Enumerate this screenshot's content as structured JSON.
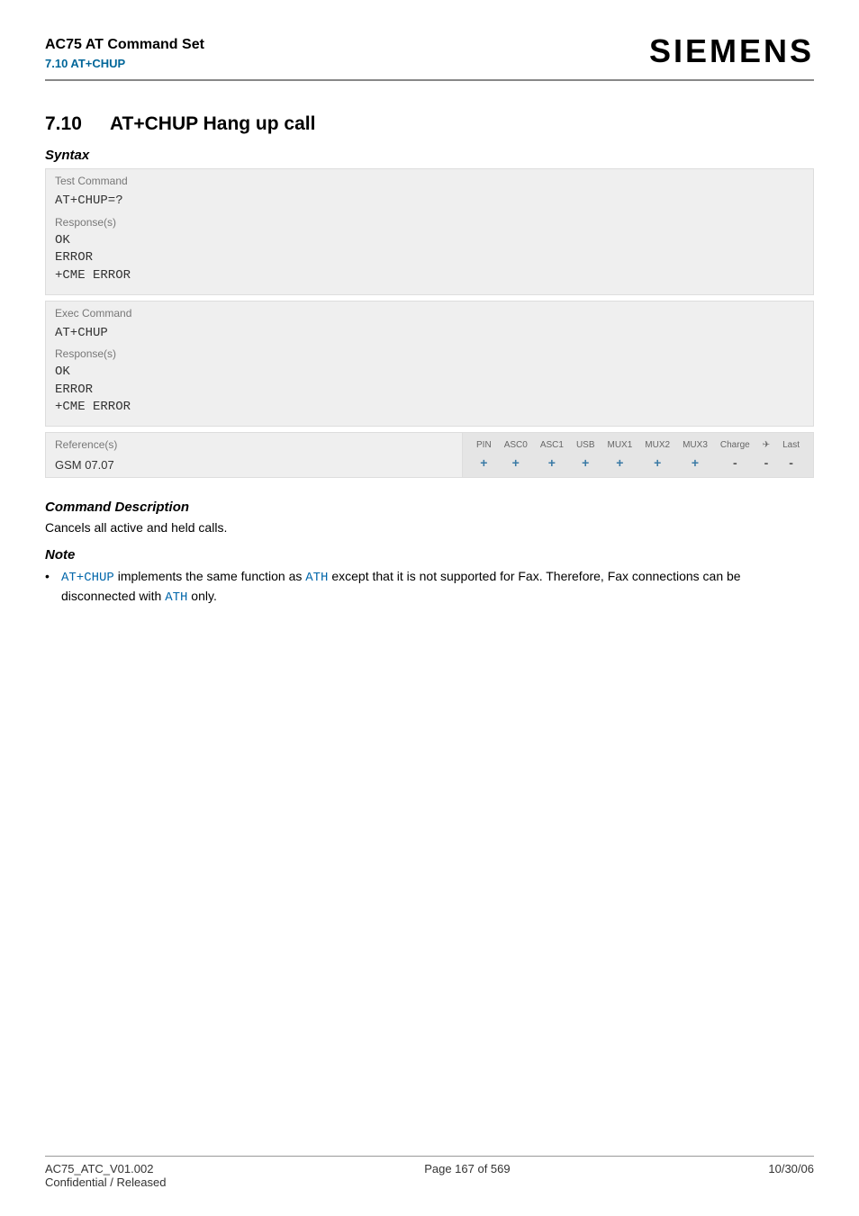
{
  "header": {
    "doc_title": "AC75 AT Command Set",
    "section_ref": "7.10 AT+CHUP",
    "brand": "SIEMENS"
  },
  "section": {
    "number": "7.10",
    "title": "AT+CHUP   Hang up call"
  },
  "syntax": {
    "heading": "Syntax",
    "test_cmd": {
      "label": "Test Command",
      "cmd": "AT+CHUP=?",
      "responses_label": "Response(s)",
      "lines": [
        "OK",
        "ERROR",
        "+CME ERROR"
      ]
    },
    "exec_cmd": {
      "label": "Exec Command",
      "cmd": "AT+CHUP",
      "responses_label": "Response(s)",
      "lines": [
        "OK",
        "ERROR",
        "+CME ERROR"
      ]
    }
  },
  "reference": {
    "label": "Reference(s)",
    "value": "GSM 07.07",
    "cols": [
      "PIN",
      "ASC0",
      "ASC1",
      "USB",
      "MUX1",
      "MUX2",
      "MUX3",
      "Charge",
      "✈",
      "Last"
    ],
    "vals": [
      "+",
      "+",
      "+",
      "+",
      "+",
      "+",
      "+",
      "-",
      "-",
      "-"
    ]
  },
  "cmd_desc": {
    "heading": "Command Description",
    "body": "Cancels all active and held calls."
  },
  "note": {
    "heading": "Note",
    "link1": "AT+CHUP",
    "text1": " implements the same function as ",
    "link2": "ATH",
    "text2": " except that it is not supported for Fax. Therefore, Fax connections can be disconnected with ",
    "link3": "ATH",
    "text3": " only."
  },
  "footer": {
    "left1": "AC75_ATC_V01.002",
    "left2": "Confidential / Released",
    "center": "Page 167 of 569",
    "right": "10/30/06"
  }
}
